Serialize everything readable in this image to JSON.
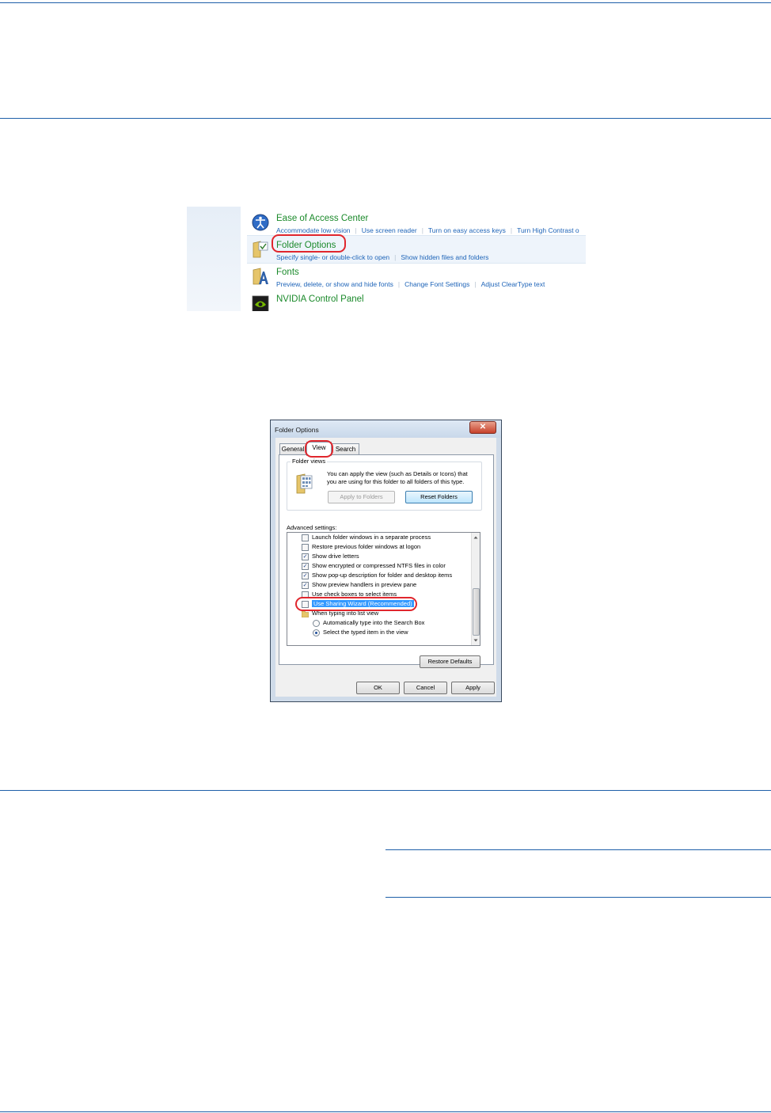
{
  "control_panel": {
    "items": [
      {
        "title": "Ease of Access Center",
        "links": [
          "Accommodate low vision",
          "Use screen reader",
          "Turn on easy access keys",
          "Turn High Contrast o"
        ],
        "icon": "ease-of-access-icon"
      },
      {
        "title": "Folder Options",
        "links": [
          "Specify single- or double-click to open",
          "Show hidden files and folders"
        ],
        "icon": "folder-options-icon"
      },
      {
        "title": "Fonts",
        "links": [
          "Preview, delete, or show and hide fonts",
          "Change Font Settings",
          "Adjust ClearType text"
        ],
        "icon": "fonts-icon"
      },
      {
        "title": "NVIDIA Control Panel",
        "links": [],
        "icon": "nvidia-icon"
      }
    ]
  },
  "dialog": {
    "title": "Folder Options",
    "close_glyph": "✕",
    "tabs": [
      "General",
      "View",
      "Search"
    ],
    "active_tab": "View",
    "folder_views": {
      "label": "Folder views",
      "description_line1": "You can apply the view (such as Details or Icons) that",
      "description_line2": "you are using for this folder to all folders of this type.",
      "apply_button": "Apply to Folders",
      "reset_button": "Reset Folders"
    },
    "advanced_label": "Advanced settings:",
    "settings": [
      {
        "label": "Launch folder windows in a separate process",
        "type": "checkbox",
        "checked": false
      },
      {
        "label": "Restore previous folder windows at logon",
        "type": "checkbox",
        "checked": false
      },
      {
        "label": "Show drive letters",
        "type": "checkbox",
        "checked": true
      },
      {
        "label": "Show encrypted or compressed NTFS files in color",
        "type": "checkbox",
        "checked": true
      },
      {
        "label": "Show pop-up description for folder and desktop items",
        "type": "checkbox",
        "checked": true
      },
      {
        "label": "Show preview handlers in preview pane",
        "type": "checkbox",
        "checked": true
      },
      {
        "label": "Use check boxes to select items",
        "type": "checkbox",
        "checked": false
      },
      {
        "label": "Use Sharing Wizard (Recommended)",
        "type": "checkbox",
        "checked": false,
        "selected": true
      },
      {
        "label": "When typing into list view",
        "type": "folder"
      },
      {
        "label": "Automatically type into the Search Box",
        "type": "radio",
        "checked": false
      },
      {
        "label": "Select the typed item in the view",
        "type": "radio",
        "checked": true
      }
    ],
    "restore_button": "Restore Defaults",
    "ok_button": "OK",
    "cancel_button": "Cancel",
    "apply_button": "Apply"
  },
  "colors": {
    "rule": "#1e5fa8",
    "link": "#1e64b8",
    "title_green": "#1b8a2b",
    "highlight_red": "#e0262d",
    "selection_blue": "#3399ff"
  }
}
